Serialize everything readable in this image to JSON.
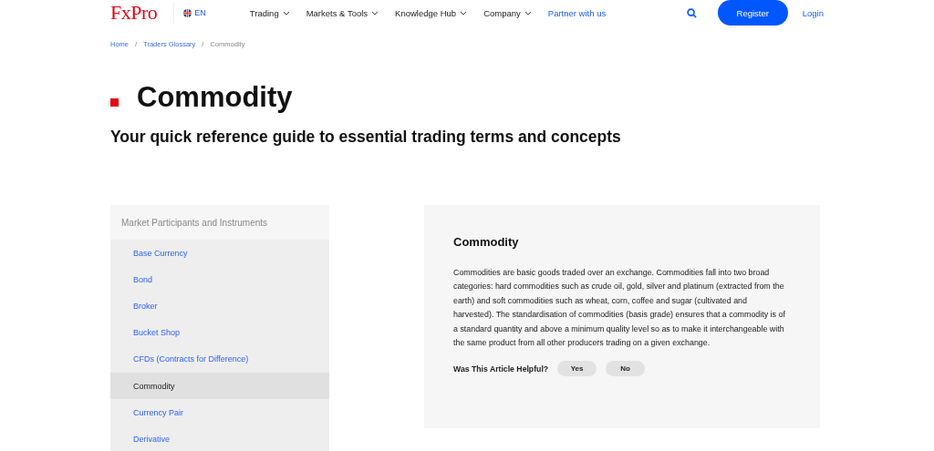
{
  "header": {
    "logo": "FxPro",
    "language": "EN",
    "nav": [
      {
        "label": "Trading",
        "kind": "menu"
      },
      {
        "label": "Markets & Tools",
        "kind": "menu"
      },
      {
        "label": "Knowledge Hub",
        "kind": "menu"
      },
      {
        "label": "Company",
        "kind": "menu"
      },
      {
        "label": "Partner with us",
        "kind": "link"
      }
    ],
    "register": "Register",
    "login": "Login"
  },
  "breadcrumb": [
    {
      "label": "Home",
      "current": false
    },
    {
      "label": "Traders Glossary",
      "current": false
    },
    {
      "label": "Commodity",
      "current": true
    }
  ],
  "breadcrumb_separator": "/",
  "title": "Commodity",
  "subtitle": "Your quick reference guide to essential trading terms and concepts",
  "sidebar": {
    "heading": "Market Participants and Instruments",
    "items": [
      {
        "label": "Base Currency",
        "selected": false
      },
      {
        "label": "Bond",
        "selected": false
      },
      {
        "label": "Broker",
        "selected": false
      },
      {
        "label": "Bucket Shop",
        "selected": false
      },
      {
        "label": "CFDs (Contracts for Difference)",
        "selected": false
      },
      {
        "label": "Commodity",
        "selected": true
      },
      {
        "label": "Currency Pair",
        "selected": false
      },
      {
        "label": "Derivative",
        "selected": false
      }
    ]
  },
  "article": {
    "title": "Commodity",
    "body": "Commodities are basic goods traded over an exchange. Commodities fall into two broad categories: hard commodities such as crude oil, gold, silver and platinum (extracted from the earth) and soft commodities such as wheat, corn, coffee and sugar (cultivated and harvested). The standardisation of commodities (basis grade) ensures that a commodity is of a standard quantity and above a minimum quality level so as to make it interchangeable with the same product from all other producers trading on a given exchange.",
    "feedback": {
      "question": "Was This Article Helpful?",
      "buttons": [
        "Yes",
        "No"
      ]
    }
  }
}
